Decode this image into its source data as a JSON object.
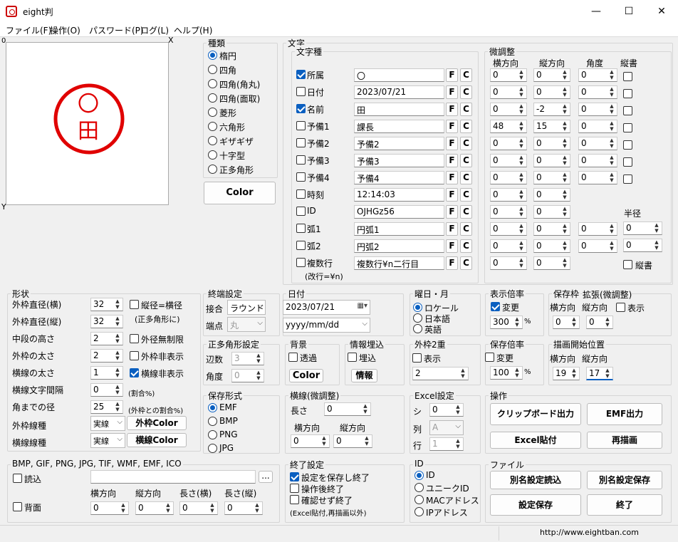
{
  "window": {
    "title": "eight判"
  },
  "menu": [
    "ファイル(F)",
    "操作(O)",
    "パスワード(P)",
    "ログ(L)",
    "ヘルプ(H)"
  ],
  "preview": {
    "x_label": "X",
    "y_label": "Y",
    "origin": "0",
    "stamp_top": "〇",
    "stamp_bottom": "田",
    "stamp_color": "#e00000"
  },
  "shape_type": {
    "title": "種類",
    "options": [
      "楕円",
      "四角",
      "四角(角丸)",
      "四角(面取)",
      "菱形",
      "六角形",
      "ギザギザ",
      "十字型",
      "正多角形"
    ],
    "selected": "楕円",
    "color_label": "Color"
  },
  "text": {
    "title": "文字",
    "sub_title": "文字種",
    "rows": [
      {
        "label": "所属",
        "checked": true,
        "value": "〇"
      },
      {
        "label": "日付",
        "checked": false,
        "value": "2023/07/21"
      },
      {
        "label": "名前",
        "checked": true,
        "value": "田"
      },
      {
        "label": "予備1",
        "checked": false,
        "value": "課長"
      },
      {
        "label": "予備2",
        "checked": false,
        "value": "予備2"
      },
      {
        "label": "予備3",
        "checked": false,
        "value": "予備3"
      },
      {
        "label": "予備4",
        "checked": false,
        "value": "予備4"
      },
      {
        "label": "時刻",
        "checked": false,
        "value": "12:14:03"
      },
      {
        "label": "ID",
        "checked": false,
        "value": "OJHGz56"
      },
      {
        "label": "弧1",
        "checked": false,
        "value": "円弧1"
      },
      {
        "label": "弧2",
        "checked": false,
        "value": "円弧2"
      },
      {
        "label": "複数行",
        "checked": false,
        "value": "複数行¥n二行目"
      }
    ],
    "f_label": "F",
    "c_label": "C",
    "multiline_note": "(改行=¥n)"
  },
  "fine": {
    "title": "微調整",
    "h_label": "横方向",
    "v_label": "縦方向",
    "angle_label": "角度",
    "vertical_label": "縦書",
    "h": [
      "0",
      "0",
      "0",
      "48",
      "0",
      "0",
      "0",
      "0",
      "0",
      "0",
      "0",
      "0"
    ],
    "v": [
      "0",
      "0",
      "-2",
      "15",
      "0",
      "0",
      "0",
      "0",
      "0",
      "0",
      "0",
      "0"
    ],
    "a": [
      "0",
      "0",
      "0",
      "0",
      "0",
      "0",
      "0",
      "",
      "",
      "0",
      "0",
      ""
    ],
    "radius_label": "半径",
    "radius": [
      "0",
      "0"
    ],
    "radius_vertical": "縦書"
  },
  "form": {
    "title": "形状",
    "rows": [
      {
        "label": "外枠直径(横)",
        "value": "32"
      },
      {
        "label": "外枠直径(縦)",
        "value": "32"
      },
      {
        "label": "中段の高さ",
        "value": "2"
      },
      {
        "label": "外枠の太さ",
        "value": "2"
      },
      {
        "label": "横線の太さ",
        "value": "1"
      },
      {
        "label": "横線文字間隔",
        "value": "0"
      },
      {
        "label": "角までの径",
        "value": "25"
      }
    ],
    "chk_equal": "縦径=横径",
    "chk_equal_note": "(正多角形に)",
    "chk_unlimited": "外径無制限",
    "chk_hide_outer": "外枠非表示",
    "chk_hide_line": "横線非表示",
    "ratio_note": "(割合%)",
    "ratio_note2": "(外枠との割合%)",
    "outer_line_label": "外枠線種",
    "outer_line_value": "実線",
    "outer_color_btn": "外枠Color",
    "hline_label": "横線線種",
    "hline_value": "実線",
    "hline_color_btn": "横線Color"
  },
  "end": {
    "title": "終端設定",
    "join_label": "接合",
    "join_value": "ラウンド",
    "cap_label": "端点",
    "cap_value": "丸"
  },
  "date": {
    "title": "日付",
    "value": "2023/07/21",
    "format": "yyyy/mm/dd"
  },
  "weekday": {
    "title": "曜日・月",
    "options": [
      "ロケール",
      "日本語",
      "英語"
    ],
    "selected": "ロケール"
  },
  "display_scale": {
    "title": "表示倍率",
    "chk": "変更",
    "value": "300",
    "unit": "%"
  },
  "save_frame": {
    "title": "保存枠",
    "h_label": "横方向",
    "h": "0"
  },
  "expand": {
    "title": "拡張(微調整)",
    "v_label": "縦方向",
    "v": "0",
    "chk": "表示"
  },
  "polygon": {
    "title": "正多角形設定",
    "sides_label": "辺数",
    "sides": "3",
    "angle_label": "角度",
    "angle": "0"
  },
  "bg": {
    "title": "背景",
    "chk": "透過",
    "btn": "Color"
  },
  "info": {
    "title": "情報埋込",
    "chk": "埋込",
    "btn": "情報"
  },
  "outer2": {
    "title": "外枠2重",
    "chk": "表示",
    "value": "2"
  },
  "save_scale": {
    "title": "保存倍率",
    "chk": "変更",
    "value": "100",
    "unit": "%"
  },
  "draw_start": {
    "title": "描画開始位置",
    "h_label": "横方向",
    "v_label": "縦方向",
    "h": "19",
    "v": "17"
  },
  "save_format": {
    "title": "保存形式",
    "options": [
      "EMF",
      "BMP",
      "PNG",
      "JPG"
    ],
    "selected": "EMF"
  },
  "hline_fine": {
    "title": "横線(微調整)",
    "length_label": "長さ",
    "length": "0",
    "h_label": "横方向",
    "v_label": "縦方向",
    "h": "0",
    "v": "0"
  },
  "excel": {
    "title": "Excel設定",
    "sheet_label": "シ",
    "sheet": "0",
    "col_label": "列",
    "col": "A",
    "row_label": "行",
    "row": "1"
  },
  "ops": {
    "title": "操作",
    "clipboard": "クリップボード出力",
    "emf": "EMF出力",
    "excel": "Excel貼付",
    "redraw": "再描画"
  },
  "image": {
    "title": "BMP, GIF, PNG, JPG, TIF, WMF, EMF, ICO",
    "read_label": "読込",
    "browse": "...",
    "bg_label": "背面",
    "h_label": "横方向",
    "v_label": "縦方向",
    "w_label": "長さ(横)",
    "hgt_label": "長さ(縦)",
    "h": "0",
    "v": "0",
    "w": "0",
    "hgt": "0"
  },
  "exit": {
    "title": "終了設定",
    "opt1": "設定を保存し終了",
    "opt2": "操作後終了",
    "opt3": "確認せず終了",
    "note": "(Excel貼付,再描画以外)",
    "opt1_checked": true
  },
  "id": {
    "title": "ID",
    "options": [
      "ID",
      "ユニークID",
      "MACアドレス",
      "IPアドレス"
    ],
    "selected": "ID"
  },
  "file": {
    "title": "ファイル",
    "load_as": "別名設定読込",
    "save_as": "別名設定保存",
    "save": "設定保存",
    "quit": "終了"
  },
  "status": {
    "url": "http://www.eightban.com"
  }
}
